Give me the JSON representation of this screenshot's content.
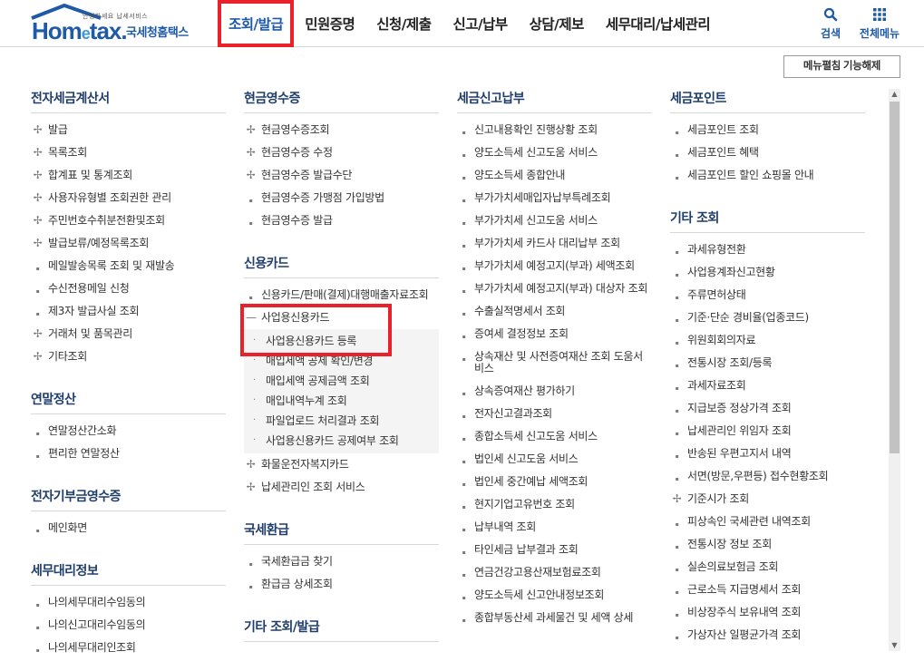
{
  "header": {
    "logo_small": "안녕하세요 납세서비스",
    "logo_home": "Hom",
    "logo_e": "e",
    "logo_tax": "tax.",
    "logo_kor": "국세청홈택스",
    "nav": [
      "조회/발급",
      "민원증명",
      "신청/제출",
      "신고/납부",
      "상담/제보",
      "세무대리/납세관리"
    ],
    "search_label": "검색",
    "menu_label": "전체메뉴"
  },
  "fold_button": "메뉴펼침 기능해제",
  "columns": [
    {
      "sections": [
        {
          "title": "전자세금계산서",
          "items": [
            {
              "label": "발급",
              "marker": "plus"
            },
            {
              "label": "목록조회",
              "marker": "plus"
            },
            {
              "label": "합계표 및 통계조회",
              "marker": "plus"
            },
            {
              "label": "사용자유형별 조회권한 관리",
              "marker": "plus"
            },
            {
              "label": "주민번호수취분전환및조회",
              "marker": "plus"
            },
            {
              "label": "발급보류/예정목록조회",
              "marker": "plus"
            },
            {
              "label": "메일발송목록 조회 및 재발송",
              "marker": "dot"
            },
            {
              "label": "수신전용메일 신청",
              "marker": "dot"
            },
            {
              "label": "제3자 발급사실 조회",
              "marker": "dot"
            },
            {
              "label": "거래처 및 품목관리",
              "marker": "plus"
            },
            {
              "label": "기타조회",
              "marker": "plus"
            }
          ]
        },
        {
          "title": "연말정산",
          "items": [
            {
              "label": "연말정산간소화",
              "marker": "dot"
            },
            {
              "label": "편리한 연말정산",
              "marker": "dot"
            }
          ]
        },
        {
          "title": "전자기부금영수증",
          "items": [
            {
              "label": "메인화면",
              "marker": "dot"
            }
          ]
        },
        {
          "title": "세무대리정보",
          "items": [
            {
              "label": "나의세무대리수임동의",
              "marker": "dot"
            },
            {
              "label": "나의신고대리수임동의",
              "marker": "dot"
            },
            {
              "label": "나의세무대리인조회",
              "marker": "dot"
            }
          ]
        }
      ]
    },
    {
      "sections": [
        {
          "title": "현금영수증",
          "items": [
            {
              "label": "현금영수증조회",
              "marker": "plus"
            },
            {
              "label": "현금영수증 수정",
              "marker": "plus"
            },
            {
              "label": "현금영수증 발급수단",
              "marker": "plus"
            },
            {
              "label": "현금영수증 가맹점 가입방법",
              "marker": "dot"
            },
            {
              "label": "현금영수증 발급",
              "marker": "dot"
            }
          ]
        },
        {
          "title": "신용카드",
          "items": [
            {
              "label": "신용카드/판매(결제)대행매출자료조회",
              "marker": "dot"
            },
            {
              "label": "사업용신용카드",
              "marker": "minus",
              "expanded": true,
              "sub": [
                "사업용신용카드 등록",
                "매입세액 공제 확인/변경",
                "매입세액 공제금액 조회",
                "매입내역누계 조회",
                "파일업로드 처리결과 조회",
                "사업용신용카드 공제여부 조회"
              ]
            },
            {
              "label": "화물운전자복지카드",
              "marker": "plus"
            },
            {
              "label": "납세관리인 조회 서비스",
              "marker": "plus"
            }
          ]
        },
        {
          "title": "국세환급",
          "items": [
            {
              "label": "국세환급금 찾기",
              "marker": "dot"
            },
            {
              "label": "환급금 상세조회",
              "marker": "dot"
            }
          ]
        },
        {
          "title": "기타 조회/발급",
          "items": []
        }
      ]
    },
    {
      "sections": [
        {
          "title": "세금신고납부",
          "items": [
            {
              "label": "신고내용확인 진행상황 조회",
              "marker": "dot"
            },
            {
              "label": "양도소득세 신고도움 서비스",
              "marker": "dot"
            },
            {
              "label": "양도소득세 종합안내",
              "marker": "dot"
            },
            {
              "label": "부가가치세매입자납부특례조회",
              "marker": "dot"
            },
            {
              "label": "부가가치세 신고도움 서비스",
              "marker": "dot"
            },
            {
              "label": "부가가치세 카드사 대리납부 조회",
              "marker": "dot"
            },
            {
              "label": "부가가치세 예정고지(부과) 세액조회",
              "marker": "dot"
            },
            {
              "label": "부가가치세 예정고지(부과) 대상자 조회",
              "marker": "dot"
            },
            {
              "label": "수출실적명세서 조회",
              "marker": "dot"
            },
            {
              "label": "증여세 결정정보 조회",
              "marker": "dot"
            },
            {
              "label": "상속재산 및 사전증여재산 조회 도움서비스",
              "marker": "dot"
            },
            {
              "label": "상속증여재산 평가하기",
              "marker": "dot"
            },
            {
              "label": "전자신고결과조회",
              "marker": "dot"
            },
            {
              "label": "종합소득세 신고도움 서비스",
              "marker": "dot"
            },
            {
              "label": "법인세 신고도움 서비스",
              "marker": "dot"
            },
            {
              "label": "법인세 중간예납 세액조회",
              "marker": "dot"
            },
            {
              "label": "현지기업고유번호 조회",
              "marker": "dot"
            },
            {
              "label": "납부내역 조회",
              "marker": "dot"
            },
            {
              "label": "타인세금 납부결과 조회",
              "marker": "dot"
            },
            {
              "label": "연금건강고용산재보험료조회",
              "marker": "dot"
            },
            {
              "label": "양도소득세 신고안내정보조회",
              "marker": "dot"
            },
            {
              "label": "종합부동산세 과세물건 및 세액 상세",
              "marker": "dot"
            }
          ]
        }
      ]
    },
    {
      "sections": [
        {
          "title": "세금포인트",
          "items": [
            {
              "label": "세금포인트 조회",
              "marker": "dot"
            },
            {
              "label": "세금포인트 혜택",
              "marker": "dot"
            },
            {
              "label": "세금포인트 할인 쇼핑몰 안내",
              "marker": "dot"
            }
          ]
        },
        {
          "title": "기타 조회",
          "items": [
            {
              "label": "과세유형전환",
              "marker": "dot"
            },
            {
              "label": "사업용계좌신고현황",
              "marker": "dot"
            },
            {
              "label": "주류면허상태",
              "marker": "dot"
            },
            {
              "label": "기준·단순 경비율(업종코드)",
              "marker": "dot"
            },
            {
              "label": "위원회회의자료",
              "marker": "dot"
            },
            {
              "label": "전통시장 조회/등록",
              "marker": "dot"
            },
            {
              "label": "과세자료조회",
              "marker": "dot"
            },
            {
              "label": "지급보증 정상가격 조회",
              "marker": "dot"
            },
            {
              "label": "납세관리인 위임자 조회",
              "marker": "dot"
            },
            {
              "label": "반송된 우편고지서 내역",
              "marker": "dot"
            },
            {
              "label": "서면(방문,우편등) 접수현황조회",
              "marker": "dot"
            },
            {
              "label": "기준시가 조회",
              "marker": "plus"
            },
            {
              "label": "피상속인 국세관련 내역조회",
              "marker": "dot"
            },
            {
              "label": "전통시장 정보 조회",
              "marker": "dot"
            },
            {
              "label": "실손의료보험금 조회",
              "marker": "dot"
            },
            {
              "label": "근로소득 지급명세서 조회",
              "marker": "dot"
            },
            {
              "label": "비상장주식 보유내역 조회",
              "marker": "dot"
            },
            {
              "label": "가상자산 일평균가격 조회",
              "marker": "dot"
            }
          ]
        }
      ]
    }
  ]
}
